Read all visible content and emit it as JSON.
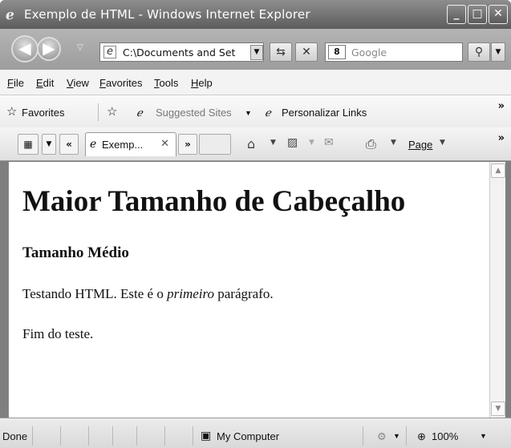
{
  "window": {
    "title": "Exemplo de HTML - Windows Internet Explorer",
    "controls": {
      "minimize": "_",
      "maximize": "□",
      "close": "✕"
    }
  },
  "address_bar": {
    "value": "C:\\Documents and Set",
    "search_placeholder": "Google"
  },
  "menu": [
    "File",
    "Edit",
    "View",
    "Favorites",
    "Tools",
    "Help"
  ],
  "favorites_bar": {
    "favorites_label": "Favorites",
    "suggested_sites": "Suggested Sites",
    "personalize_links": "Personalizar Links"
  },
  "tabs": {
    "active_tab_label": "Exemp...",
    "page_menu": "Page"
  },
  "page": {
    "heading1": "Maior Tamanho de Cabeçalho",
    "heading3": "Tamanho Médio",
    "para1_before": "Testando HTML. Este é o ",
    "para1_emph": "primeiro",
    "para1_after": " parágrafo.",
    "para2": "Fim do teste."
  },
  "status_bar": {
    "status": "Done",
    "zone": "My Computer",
    "zoom": "100%"
  }
}
